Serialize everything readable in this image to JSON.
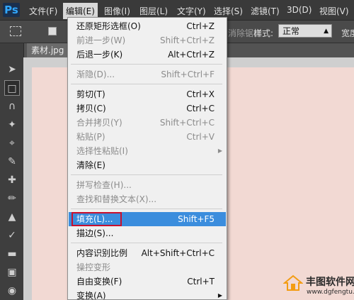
{
  "app_logo": "Ps",
  "menubar": [
    "文件(F)",
    "编辑(E)",
    "图像(I)",
    "图层(L)",
    "文字(Y)",
    "选择(S)",
    "滤镜(T)",
    "3D(D)",
    "视图(V)"
  ],
  "options": {
    "feather_hint": "消除锯齿",
    "style_label": "样式:",
    "style_value": "正常",
    "width_label": "宽度"
  },
  "document": {
    "tab_title": "素材.jpg"
  },
  "edit_menu": {
    "items": [
      {
        "label": "还原矩形选框(O)",
        "shortcut": "Ctrl+Z"
      },
      {
        "label": "前进一步(W)",
        "shortcut": "Shift+Ctrl+Z"
      },
      {
        "label": "后退一步(K)",
        "shortcut": "Alt+Ctrl+Z"
      },
      {
        "label": "渐隐(D)...",
        "shortcut": "Shift+Ctrl+F"
      },
      {
        "label": "剪切(T)",
        "shortcut": "Ctrl+X"
      },
      {
        "label": "拷贝(C)",
        "shortcut": "Ctrl+C"
      },
      {
        "label": "合并拷贝(Y)",
        "shortcut": "Shift+Ctrl+C"
      },
      {
        "label": "粘贴(P)",
        "shortcut": "Ctrl+V"
      },
      {
        "label": "选择性粘贴(I)",
        "shortcut": ""
      },
      {
        "label": "清除(E)",
        "shortcut": ""
      },
      {
        "label": "拼写检查(H)...",
        "shortcut": ""
      },
      {
        "label": "查找和替换文本(X)...",
        "shortcut": ""
      },
      {
        "label": "填充(L)...",
        "shortcut": "Shift+F5"
      },
      {
        "label": "描边(S)...",
        "shortcut": ""
      },
      {
        "label": "内容识别比例",
        "shortcut": "Alt+Shift+Ctrl+C"
      },
      {
        "label": "操控变形",
        "shortcut": ""
      },
      {
        "label": "自由变换(F)",
        "shortcut": "Ctrl+T"
      },
      {
        "label": "变换(A)",
        "shortcut": ""
      }
    ]
  },
  "watermark": {
    "title": "丰图软件网",
    "url": "www.dgfengtu.com"
  },
  "colors": {
    "highlight": "#3b8ddd",
    "annotation_box": "#c8102e",
    "canvas": "#f2d9d3"
  }
}
